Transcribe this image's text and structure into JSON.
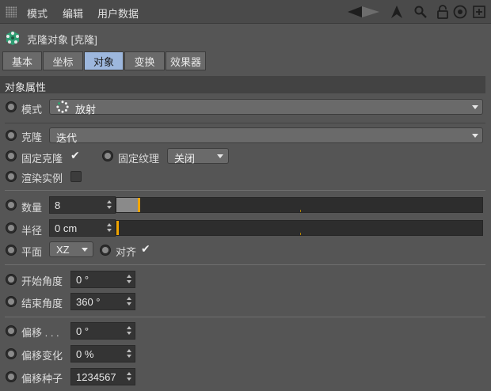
{
  "menubar": {
    "items": [
      "模式",
      "编辑",
      "用户数据"
    ],
    "icons": [
      "back-arrow-icon",
      "cursor-icon",
      "search-icon",
      "lock-icon",
      "target-icon",
      "new-panel-icon"
    ]
  },
  "object": {
    "icon": "cloner-icon",
    "title": "克隆对象 [克隆]"
  },
  "tabs": [
    {
      "label": "基本",
      "active": false
    },
    {
      "label": "坐标",
      "active": false
    },
    {
      "label": "对象",
      "active": true
    },
    {
      "label": "变换",
      "active": false
    },
    {
      "label": "效果器",
      "active": false
    }
  ],
  "section": {
    "title": "对象属性"
  },
  "mode": {
    "label": "模式",
    "value": "放射",
    "value_icon": "radial-icon"
  },
  "clone": {
    "label": "克隆",
    "value": "迭代"
  },
  "fix_clone": {
    "label": "固定克隆",
    "checked": true
  },
  "fix_texture": {
    "label": "固定纹理",
    "value": "关闭"
  },
  "render_instances": {
    "label": "渲染实例",
    "checked": false
  },
  "count": {
    "label": "数量",
    "value": "8",
    "slider_fraction": 0.06
  },
  "radius": {
    "label": "半径",
    "value": "0 cm",
    "slider_fraction": 0.0
  },
  "plane": {
    "label": "平面",
    "value": "XZ"
  },
  "align": {
    "label": "对齐",
    "checked": true
  },
  "start_angle": {
    "label": "开始角度",
    "value": "0 °"
  },
  "end_angle": {
    "label": "结束角度",
    "value": "360 °"
  },
  "offset": {
    "label": "偏移 . . .",
    "value": "0 °"
  },
  "offset_variation": {
    "label": "偏移变化",
    "value": "0 %"
  },
  "offset_seed": {
    "label": "偏移种子",
    "value": "1234567"
  },
  "colors": {
    "accent": "#f0a400",
    "active_tab": "#9db7dd",
    "panel": "#555555"
  }
}
